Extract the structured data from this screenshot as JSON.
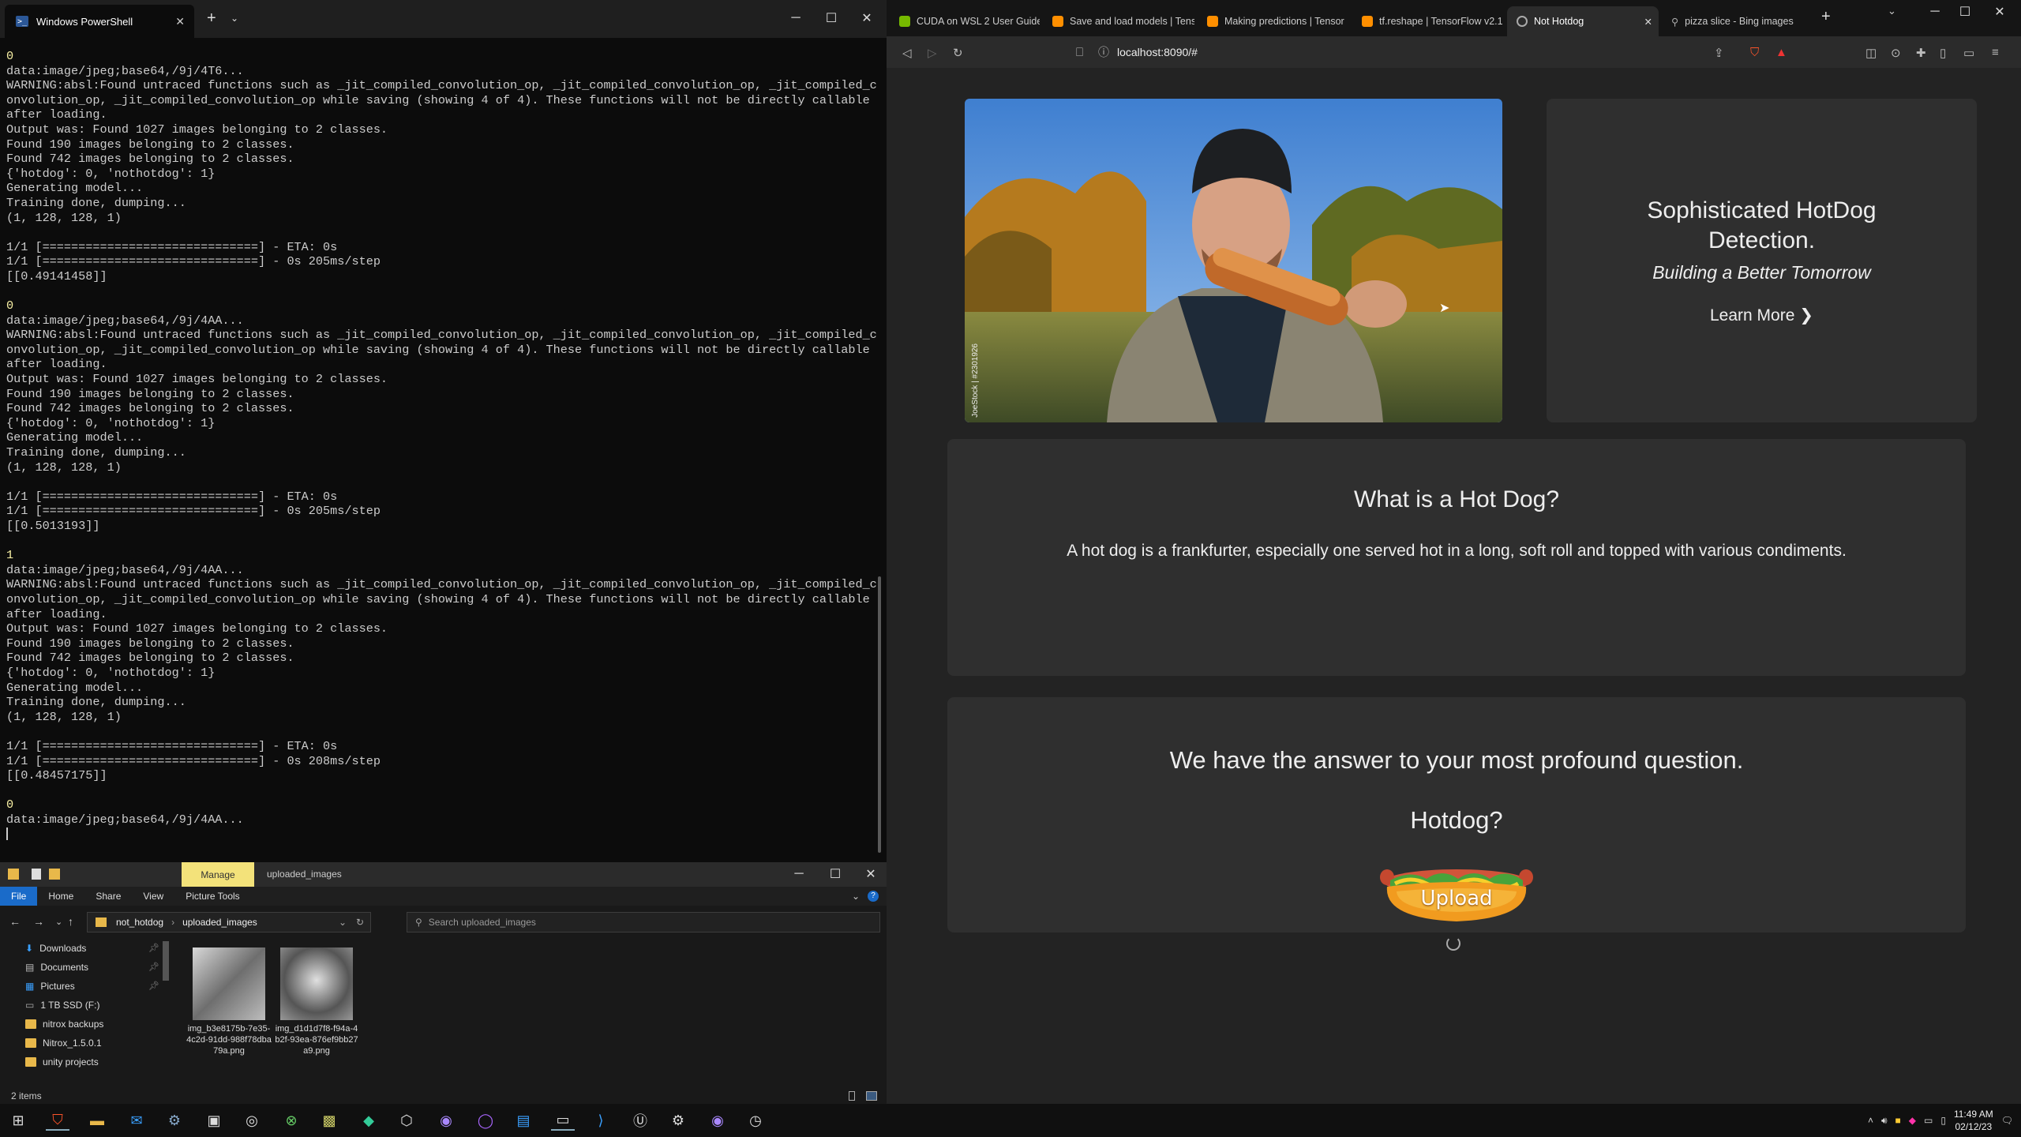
{
  "powershell": {
    "tab_title": "Windows PowerShell",
    "lines": [
      "0",
      "data:image/jpeg;base64,/9j/4T6...",
      "WARNING:absl:Found untraced functions such as _jit_compiled_convolution_op, _jit_compiled_convolution_op, _jit_compiled_c",
      "onvolution_op, _jit_compiled_convolution_op while saving (showing 4 of 4). These functions will not be directly callable",
      "after loading.",
      "Output was: Found 1027 images belonging to 2 classes.",
      "Found 190 images belonging to 2 classes.",
      "Found 742 images belonging to 2 classes.",
      "{'hotdog': 0, 'nothotdog': 1}",
      "Generating model...",
      "Training done, dumping...",
      "(1, 128, 128, 1)",
      "",
      "1/1 [==============================] - ETA: 0s",
      "1/1 [==============================] - 0s 205ms/step",
      "[[0.49141458]]",
      "",
      "0",
      "data:image/jpeg;base64,/9j/4AA...",
      "WARNING:absl:Found untraced functions such as _jit_compiled_convolution_op, _jit_compiled_convolution_op, _jit_compiled_c",
      "onvolution_op, _jit_compiled_convolution_op while saving (showing 4 of 4). These functions will not be directly callable",
      "after loading.",
      "Output was: Found 1027 images belonging to 2 classes.",
      "Found 190 images belonging to 2 classes.",
      "Found 742 images belonging to 2 classes.",
      "{'hotdog': 0, 'nothotdog': 1}",
      "Generating model...",
      "Training done, dumping...",
      "(1, 128, 128, 1)",
      "",
      "1/1 [==============================] - ETA: 0s",
      "1/1 [==============================] - 0s 205ms/step",
      "[[0.5013193]]",
      "",
      "1",
      "data:image/jpeg;base64,/9j/4AA...",
      "WARNING:absl:Found untraced functions such as _jit_compiled_convolution_op, _jit_compiled_convolution_op, _jit_compiled_c",
      "onvolution_op, _jit_compiled_convolution_op while saving (showing 4 of 4). These functions will not be directly callable",
      "after loading.",
      "Output was: Found 1027 images belonging to 2 classes.",
      "Found 190 images belonging to 2 classes.",
      "Found 742 images belonging to 2 classes.",
      "{'hotdog': 0, 'nothotdog': 1}",
      "Generating model...",
      "Training done, dumping...",
      "(1, 128, 128, 1)",
      "",
      "1/1 [==============================] - ETA: 0s",
      "1/1 [==============================] - 0s 208ms/step",
      "[[0.48457175]]",
      "",
      "0",
      "data:image/jpeg;base64,/9j/4AA..."
    ]
  },
  "explorer": {
    "manage_tab": "Manage",
    "folder_title": "uploaded_images",
    "ribbon": [
      "File",
      "Home",
      "Share",
      "View",
      "Picture Tools"
    ],
    "breadcrumb": [
      "not_hotdog",
      "uploaded_images"
    ],
    "search_placeholder": "Search uploaded_images",
    "sidebar": [
      "Downloads",
      "Documents",
      "Pictures",
      "1 TB SSD (F:)",
      "nitrox backups",
      "Nitrox_1.5.0.1",
      "unity projects"
    ],
    "files": [
      {
        "name": "img_b3e8175b-7e35-4c2d-91dd-988f78dba79a.png"
      },
      {
        "name": "img_d1d1d7f8-f94a-4b2f-93ea-876ef9bb27a9.png"
      }
    ],
    "status": "2 items"
  },
  "browser": {
    "tabs": [
      {
        "title": "CUDA on WSL 2 User Guide",
        "color": "#76b900"
      },
      {
        "title": "Save and load models | Tens",
        "color": "#ff8f00"
      },
      {
        "title": "Making predictions | Tensor",
        "color": "#ff8f00"
      },
      {
        "title": "tf.reshape | TensorFlow v2.1",
        "color": "#ff8f00"
      },
      {
        "title": "Not Hotdog",
        "color": "#888888"
      },
      {
        "title": "pizza slice - Bing images",
        "color": "#888888"
      }
    ],
    "url": "localhost:8090/#",
    "hero": {
      "title": "Sophisticated HotDog Detection.",
      "subtitle": "Building a Better Tomorrow",
      "link": "Learn More",
      "watermark": "JoeStock | #2301926"
    },
    "what": {
      "title": "What is a Hot Dog?",
      "body": "A hot dog is a frankfurter, especially one served hot in a long, soft roll and topped with various condiments."
    },
    "answer": {
      "question": "We have the answer to your most profound question.",
      "hotdog": "Hotdog?",
      "upload": "Upload"
    }
  },
  "taskbar": {
    "time": "11:49 AM",
    "date": "02/12/23"
  }
}
